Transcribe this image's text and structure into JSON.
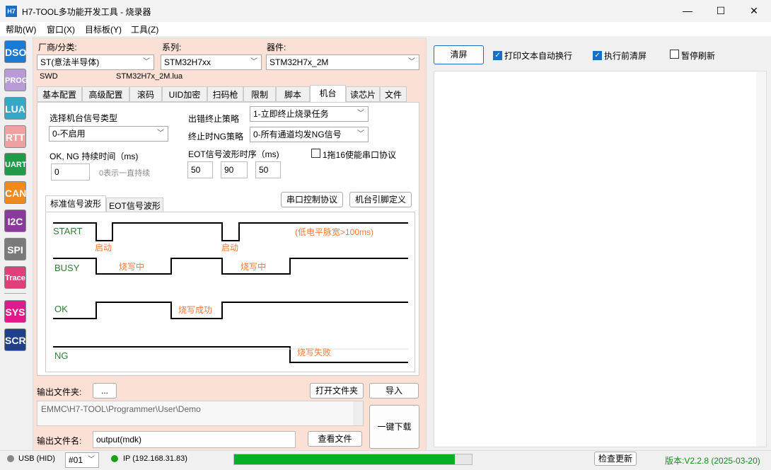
{
  "window": {
    "title": "H7-TOOL多功能开发工具 - 烧录器",
    "icon": "H7",
    "minimize": "—",
    "maximize": "☐",
    "close": "✕"
  },
  "menu": [
    "帮助(W)",
    "窗口(X)",
    "目标板(Y)",
    "工具(Z)"
  ],
  "sidebar": [
    {
      "label": "DSO",
      "color": "#1a7ad4"
    },
    {
      "label": "PROG",
      "color": "#b79ad6"
    },
    {
      "label": "LUA",
      "color": "#35a8c7"
    },
    {
      "label": "RTT",
      "color": "#f0a0a0"
    },
    {
      "label": "UART",
      "color": "#1f9b4a"
    },
    {
      "label": "CAN",
      "color": "#f08a1c"
    },
    {
      "label": "I2C",
      "color": "#8a3a9a"
    },
    {
      "label": "SPI",
      "color": "#7a7a7a"
    },
    {
      "label": "Trace",
      "color": "#e0407a"
    },
    {
      "label": "SYS",
      "color": "#e01a8a"
    },
    {
      "label": "SCR",
      "color": "#20408a"
    }
  ],
  "device": {
    "vendor_label": "厂商/分类:",
    "vendor": "ST(意法半导体)",
    "series_label": "系列:",
    "series": "STM32H7xx",
    "part_label": "器件:",
    "part": "STM32H7x_2M",
    "interface": "SWD",
    "lua_file": "STM32H7x_2M.lua"
  },
  "tabs": [
    "基本配置",
    "高级配置",
    "滚码",
    "UID加密",
    "扫码枪",
    "限制",
    "脚本",
    "机台",
    "读芯片",
    "文件"
  ],
  "active_tab": "机台",
  "machine": {
    "signal_type_label": "选择机台信号类型",
    "signal_type": "0-不启用",
    "error_policy_label": "出错终止策略",
    "error_policy": "1-立即终止烧录任务",
    "ng_policy_label": "终止时NG策略",
    "ng_policy": "0-所有通道均发NG信号",
    "duration_label": "OK, NG 持续时间（ms)",
    "duration": "0",
    "duration_hint": "0表示一直持续",
    "eot_label": "EOT信号波形时序（ms)",
    "eot_values": [
      "50",
      "90",
      "50"
    ],
    "one_to_16_label": "1拖16使能串口协议",
    "wave_tabs": [
      "标准信号波形",
      "EOT信号波形"
    ],
    "serial_protocol_btn": "串口控制协议",
    "pin_def_btn": "机台引脚定义"
  },
  "waveform": {
    "signals": [
      "START",
      "BUSY",
      "OK",
      "NG"
    ],
    "annotations": {
      "start1": "启动",
      "start2": "启动",
      "pulse_note": "(低电平脉宽>100ms)",
      "busy1": "烧写中",
      "busy2": "烧写中",
      "ok": "烧写成功",
      "ng": "烧写失败"
    },
    "signal_color": "#2e7d32",
    "note_color": "#f07a3a"
  },
  "output": {
    "folder_label": "输出文件夹:",
    "folder_btn": "...",
    "open_folder_btn": "打开文件夹",
    "import_btn": "导入",
    "path": "EMMC\\H7-TOOL\\Programmer\\User\\Demo",
    "file_label": "输出文件名:",
    "file_name": "output(mdk)",
    "view_file_btn": "查看文件",
    "download_btn": "一键下载"
  },
  "right": {
    "clear_btn": "清屏",
    "wrap_label": "打印文本自动换行",
    "wrap": true,
    "clear_before_label": "执行前清屏",
    "clear_before": true,
    "pause_label": "暂停刷新",
    "pause": false
  },
  "status": {
    "usb": "USB (HID)",
    "channel": "#01",
    "ip": "IP (192.168.31.83)",
    "progress": 0.93,
    "update_btn": "检查更新",
    "version": "版本:V2.2.8 (2025-03-20)"
  }
}
